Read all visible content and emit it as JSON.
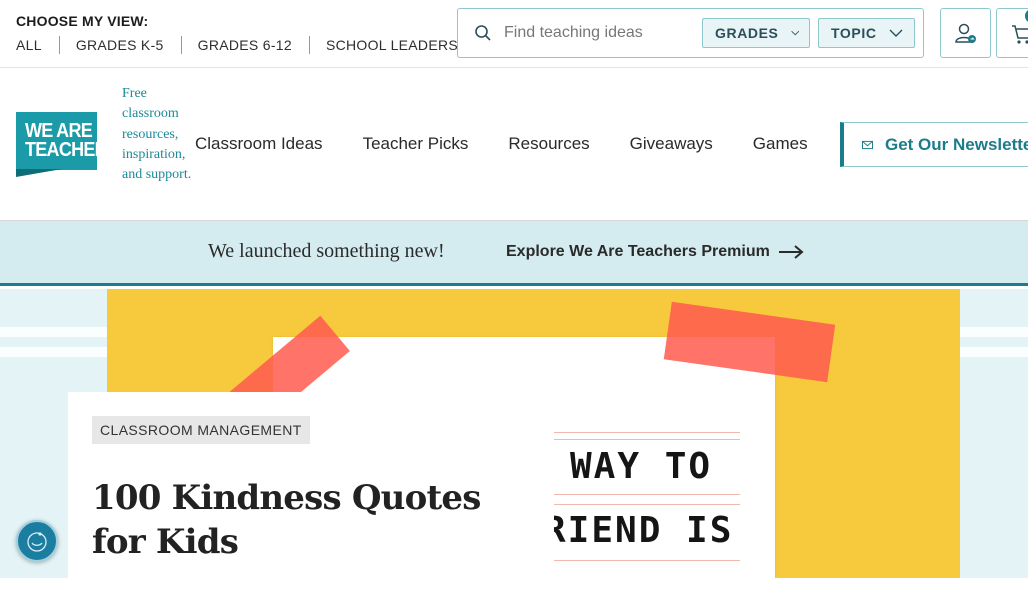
{
  "topbar": {
    "view_title": "CHOOSE MY VIEW:",
    "view_links": [
      "ALL",
      "GRADES K-5",
      "GRADES 6-12",
      "SCHOOL LEADERS"
    ],
    "search_placeholder": "Find teaching ideas",
    "grades_label": "GRADES",
    "topic_label": "TOPIC"
  },
  "logo": {
    "line1": "WE ARE",
    "line2": "TEACHERS"
  },
  "tagline": "Free classroom resources, inspiration, and support.",
  "nav": {
    "items": [
      "Classroom Ideas",
      "Teacher Picks",
      "Resources",
      "Giveaways",
      "Games"
    ],
    "newsletter_label": "Get Our Newsletter"
  },
  "banner": {
    "text": "We launched something new!",
    "link": "Explore We Are Teachers Premium"
  },
  "article": {
    "category": "CLASSROOM MANAGEMENT",
    "title": "100 Kindness Quotes for Kids",
    "image_lines": [
      "WAY TO",
      "RIEND IS"
    ]
  },
  "colors": {
    "accent": "#1b7d8a",
    "logo": "#1b9aa8",
    "hero": "#f7c93c",
    "tape": "#ff5a4f",
    "banner_bg": "#d4ecf0"
  },
  "icons": [
    "search-icon",
    "chevron-down-icon",
    "user-icon",
    "cart-icon",
    "mail-icon",
    "arrow-right-icon",
    "accessibility-icon"
  ]
}
